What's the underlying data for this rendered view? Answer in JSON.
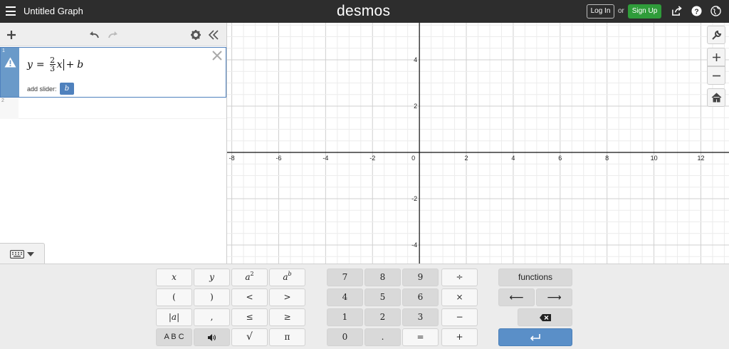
{
  "header": {
    "title": "Untitled Graph",
    "logo": "desmos",
    "login_label": "Log In",
    "or_label": "or",
    "signup_label": "Sign Up"
  },
  "expressions": [
    {
      "index": "1",
      "has_warning": true,
      "latex_parts": {
        "lhs": "y",
        "eq": "=",
        "num": "2",
        "den": "3",
        "var": "x",
        "plus": "+",
        "b": "b"
      },
      "slider_label": "add slider:",
      "slider_var": "b"
    },
    {
      "index": "2"
    }
  ],
  "graph": {
    "x_ticks": [
      "-8",
      "-6",
      "-4",
      "-2",
      "0",
      "2",
      "4",
      "6",
      "8",
      "10",
      "12"
    ],
    "y_ticks": [
      "4",
      "2",
      "-2",
      "-4"
    ],
    "x_min": -8.2,
    "x_max": 13.2,
    "y_max": 5.6,
    "y_min": -4.8
  },
  "keypad": {
    "math_keys": [
      [
        "x",
        "y",
        "a²",
        "aᵇ"
      ],
      [
        "(",
        ")",
        "<",
        ">"
      ],
      [
        "|a|",
        ",",
        "≤",
        "≥"
      ],
      [
        "A B C",
        "speaker",
        "√",
        "π"
      ]
    ],
    "num_keys": [
      [
        "7",
        "8",
        "9",
        "÷"
      ],
      [
        "4",
        "5",
        "6",
        "×"
      ],
      [
        "1",
        "2",
        "3",
        "−"
      ],
      [
        "0",
        ".",
        "=",
        "+"
      ]
    ],
    "functions_label": "functions",
    "left_arrow": "⟵",
    "right_arrow": "⟶"
  },
  "colors": {
    "header_bg": "#2d2d2d",
    "signup_green": "#2f9c3a",
    "accent_blue": "#4f81bd",
    "enter_blue": "#5a8fc8"
  }
}
